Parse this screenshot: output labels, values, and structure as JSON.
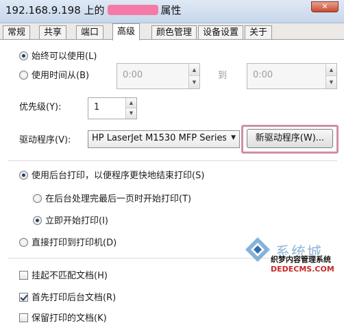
{
  "window": {
    "title_prefix": "192.168.9.198 上的",
    "title_suffix": "属性",
    "close_label": "✕"
  },
  "tabs": [
    {
      "label": "常规",
      "active": false
    },
    {
      "label": "共享",
      "active": false
    },
    {
      "label": "端口",
      "active": false
    },
    {
      "label": "高级",
      "active": true
    },
    {
      "label": "颜色管理",
      "active": false
    },
    {
      "label": "设备设置",
      "active": false
    },
    {
      "label": "关于",
      "active": false
    }
  ],
  "availability": {
    "always_label": "始终可以使用(L)",
    "always_selected": true,
    "time_label": "使用时间从(B)",
    "time_selected": false,
    "from_time": "0:00",
    "to_label": "到",
    "to_time": "0:00"
  },
  "priority": {
    "label": "优先级(Y):",
    "value": "1"
  },
  "driver": {
    "label": "驱动程序(V):",
    "selected": "HP LaserJet M1530 MFP Series",
    "new_driver_button": "新驱动程序(W)..."
  },
  "spooling": {
    "spool_label": "使用后台打印，以便程序更快地结束打印(S)",
    "spool_selected": true,
    "after_last_page_label": "在后台处理完最后一页时开始打印(T)",
    "after_last_page_selected": false,
    "immediately_label": "立即开始打印(I)",
    "immediately_selected": true,
    "direct_label": "直接打印到打印机(D)",
    "direct_selected": false
  },
  "options": {
    "hold_mismatched_label": "挂起不匹配文档(H)",
    "hold_mismatched_checked": false,
    "print_spooled_first_label": "首先打印后台文档(R)",
    "print_spooled_first_checked": true,
    "keep_printed_label": "保留打印的文档(K)",
    "keep_printed_checked": false
  },
  "watermark": {
    "logo_text": "系统城",
    "caption": "织梦内容管理系统",
    "url": "DEDECMS.COM"
  },
  "colors": {
    "highlight": "#cf8fa6",
    "redaction": "#f47aa8",
    "titlebar": "#c6d6ea"
  }
}
